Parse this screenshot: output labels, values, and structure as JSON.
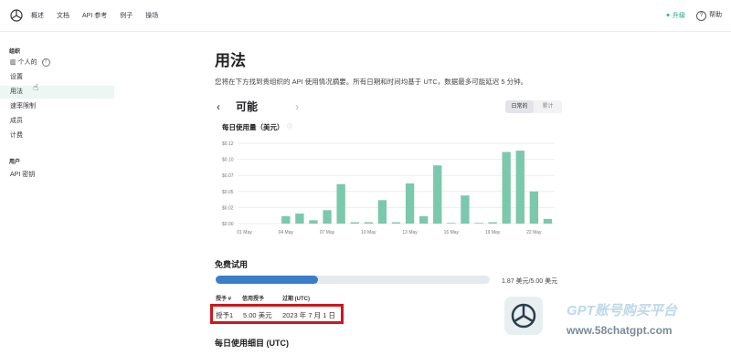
{
  "nav": {
    "items": [
      "概述",
      "文档",
      "API 参考",
      "例子",
      "操场"
    ]
  },
  "top_right": {
    "upgrade": "升级",
    "help": "帮助"
  },
  "sidebar": {
    "section_org": "组织",
    "org_items": [
      "个人的",
      "设置",
      "用法",
      "速率限制",
      "成员",
      "计费"
    ],
    "section_user": "用户",
    "user_items": [
      "API 密钥"
    ]
  },
  "main": {
    "title": "用法",
    "description": "您将在下方找到贵组织的 API 使用情况摘要。所有日期和时间均基于 UTC，数据最多可能延迟 5 分钟。",
    "period_title": "可能",
    "toggle": [
      "日常的",
      "累计"
    ],
    "chart_title": "每日使用量（美元）"
  },
  "chart_data": {
    "type": "bar",
    "ylabel": "",
    "ylim": [
      0,
      0.12
    ],
    "y_ticks": [
      "$0.12",
      "$0.10",
      "$0.07",
      "$0.05",
      "$0.02",
      "$0.00"
    ],
    "x_tick_labels": [
      "01 May",
      "04 May",
      "07 May",
      "10 May",
      "13 May",
      "16 May",
      "19 May",
      "22 May"
    ],
    "categories": [
      "01 May",
      "02 May",
      "03 May",
      "04 May",
      "05 May",
      "06 May",
      "07 May",
      "08 May",
      "09 May",
      "10 May",
      "11 May",
      "12 May",
      "13 May",
      "14 May",
      "15 May",
      "16 May",
      "17 May",
      "18 May",
      "19 May",
      "20 May",
      "21 May",
      "22 May",
      "23 May"
    ],
    "values": [
      0.0,
      0.0,
      0.0,
      0.011,
      0.015,
      0.005,
      0.02,
      0.059,
      0.002,
      0.002,
      0.035,
      0.002,
      0.06,
      0.011,
      0.087,
      0.001,
      0.042,
      0.001,
      0.002,
      0.107,
      0.109,
      0.048,
      0.007
    ],
    "bar_color": "#7cc8ad",
    "grid": true
  },
  "free_trial": {
    "title": "免费试用",
    "amount": "1.87 美元/5.00 美元",
    "progress": 0.374,
    "bar_color": "#3a7ec9",
    "columns": [
      "授予 #",
      "信用授予",
      "过期 (UTC)"
    ],
    "row": [
      "授予1",
      "5.00 美元",
      "2023 年 7 月 1 日"
    ]
  },
  "daily_detail": {
    "title": "每日使用细目 (UTC)"
  },
  "watermark": {
    "line1": "GPT账号购买平台",
    "line2": "www.58chatgpt.com"
  }
}
